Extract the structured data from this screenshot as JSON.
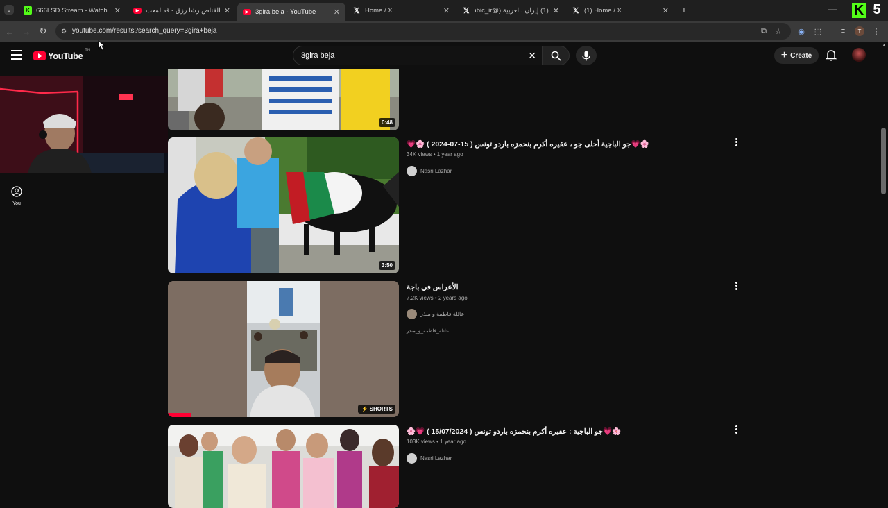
{
  "browser": {
    "tabs": [
      {
        "title": "666LSD Stream - Watch Live on",
        "favicon": "kick-icon"
      },
      {
        "title": "اغنية القناص رشا رزق - قد لمعت",
        "favicon": "youtube-icon"
      },
      {
        "title": "3gira beja - YouTube",
        "favicon": "youtube-icon",
        "active": true
      },
      {
        "title": "Home / X",
        "favicon": "x-icon"
      },
      {
        "title": "(1) إيران بالعربية (@iraninarabic_ir)",
        "favicon": "x-icon"
      },
      {
        "title": "(1) Home / X",
        "favicon": "x-icon"
      }
    ],
    "url": "youtube.com/results?search_query=3gira+beja",
    "profile_initial": "T"
  },
  "overlay": {
    "brand_letter": "K",
    "number": "5",
    "brand_color": "#53fc18"
  },
  "youtube": {
    "logo_text": "YouTube",
    "logo_suffix": "TN",
    "search_value": "3gira beja",
    "create_label": "Create",
    "sidebar_you": "You",
    "accent": "#ff0033"
  },
  "results": [
    {
      "title": "",
      "views": "",
      "age": "",
      "channel": "",
      "duration": "0:48"
    },
    {
      "title": "🌸💗جو الباجية أحلى جو ، عقيره أكرم بنحمزه باردو تونس ( 15-07-2024 ) 🌸💗",
      "views": "34K views",
      "age": "1 year ago",
      "channel": "Nasri Lazhar",
      "duration": "3:50"
    },
    {
      "title": "الأعراس في باجة",
      "views": "7.2K views",
      "age": "2 years ago",
      "channel": "عائلة فاطمة و منذر",
      "description": "عائلة_فاطمة_و_منذر.",
      "duration": "SHORTS"
    },
    {
      "title": "🌸💗جو الباجية : عقيره أكرم بنحمزه باردو تونس ( 15/07/2024 ) 💗🌸",
      "views": "103K views",
      "age": "1 year ago",
      "channel": "Nasri Lazhar",
      "duration": ""
    }
  ]
}
